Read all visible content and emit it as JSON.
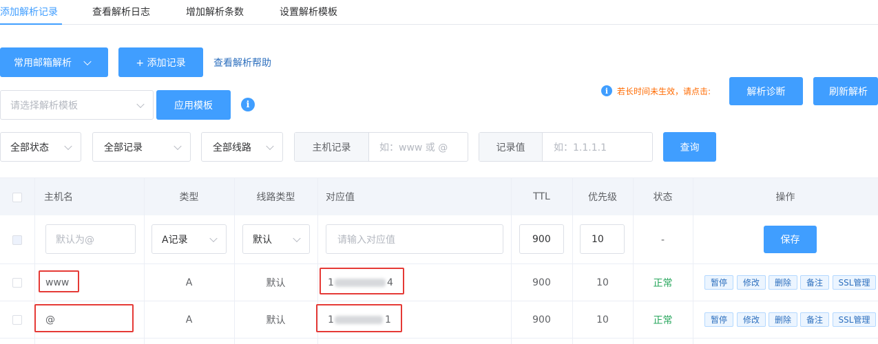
{
  "tabs": [
    "添加解析记录",
    "查看解析日志",
    "增加解析条数",
    "设置解析模板"
  ],
  "toolbar": {
    "mail_dropdown": "常用邮箱解析",
    "add_record": "+ 添加记录",
    "help_link": "查看解析帮助"
  },
  "template": {
    "placeholder": "请选择解析模板",
    "apply": "应用模板",
    "info": "i"
  },
  "notice": {
    "text": "若长时间未生效，请点击:",
    "diagnose": "解析诊断",
    "refresh": "刷新解析"
  },
  "filters": {
    "status": "全部状态",
    "records": "全部记录",
    "lines": "全部线路",
    "host_label": "主机记录",
    "host_placeholder": "如：www 或 @",
    "value_label": "记录值",
    "value_placeholder": "如：1.1.1.1",
    "query": "查询"
  },
  "table": {
    "headers": [
      "主机名",
      "类型",
      "线路类型",
      "对应值",
      "TTL",
      "优先级",
      "状态",
      "操作"
    ],
    "new_row": {
      "host_placeholder": "默认为@",
      "type": "A记录",
      "line": "默认",
      "value_placeholder": "请输入对应值",
      "ttl": "900",
      "priority": "10",
      "status": "-",
      "save": "保存"
    },
    "rows": [
      {
        "host": "www",
        "type": "A",
        "line": "默认",
        "value_first": "1",
        "value_last": "4",
        "ttl": "900",
        "priority": "10",
        "status": "正常"
      },
      {
        "host": "@",
        "type": "A",
        "line": "默认",
        "value_first": "1",
        "value_last": "1",
        "ttl": "900",
        "priority": "10",
        "status": "正常"
      }
    ],
    "actions": [
      "暂停",
      "修改",
      "删除",
      "备注",
      "SSL管理"
    ]
  },
  "colors": {
    "accent": "#409eff",
    "ok": "#26a65b",
    "notice": "#ff6a00",
    "highlight": "#e53935"
  }
}
